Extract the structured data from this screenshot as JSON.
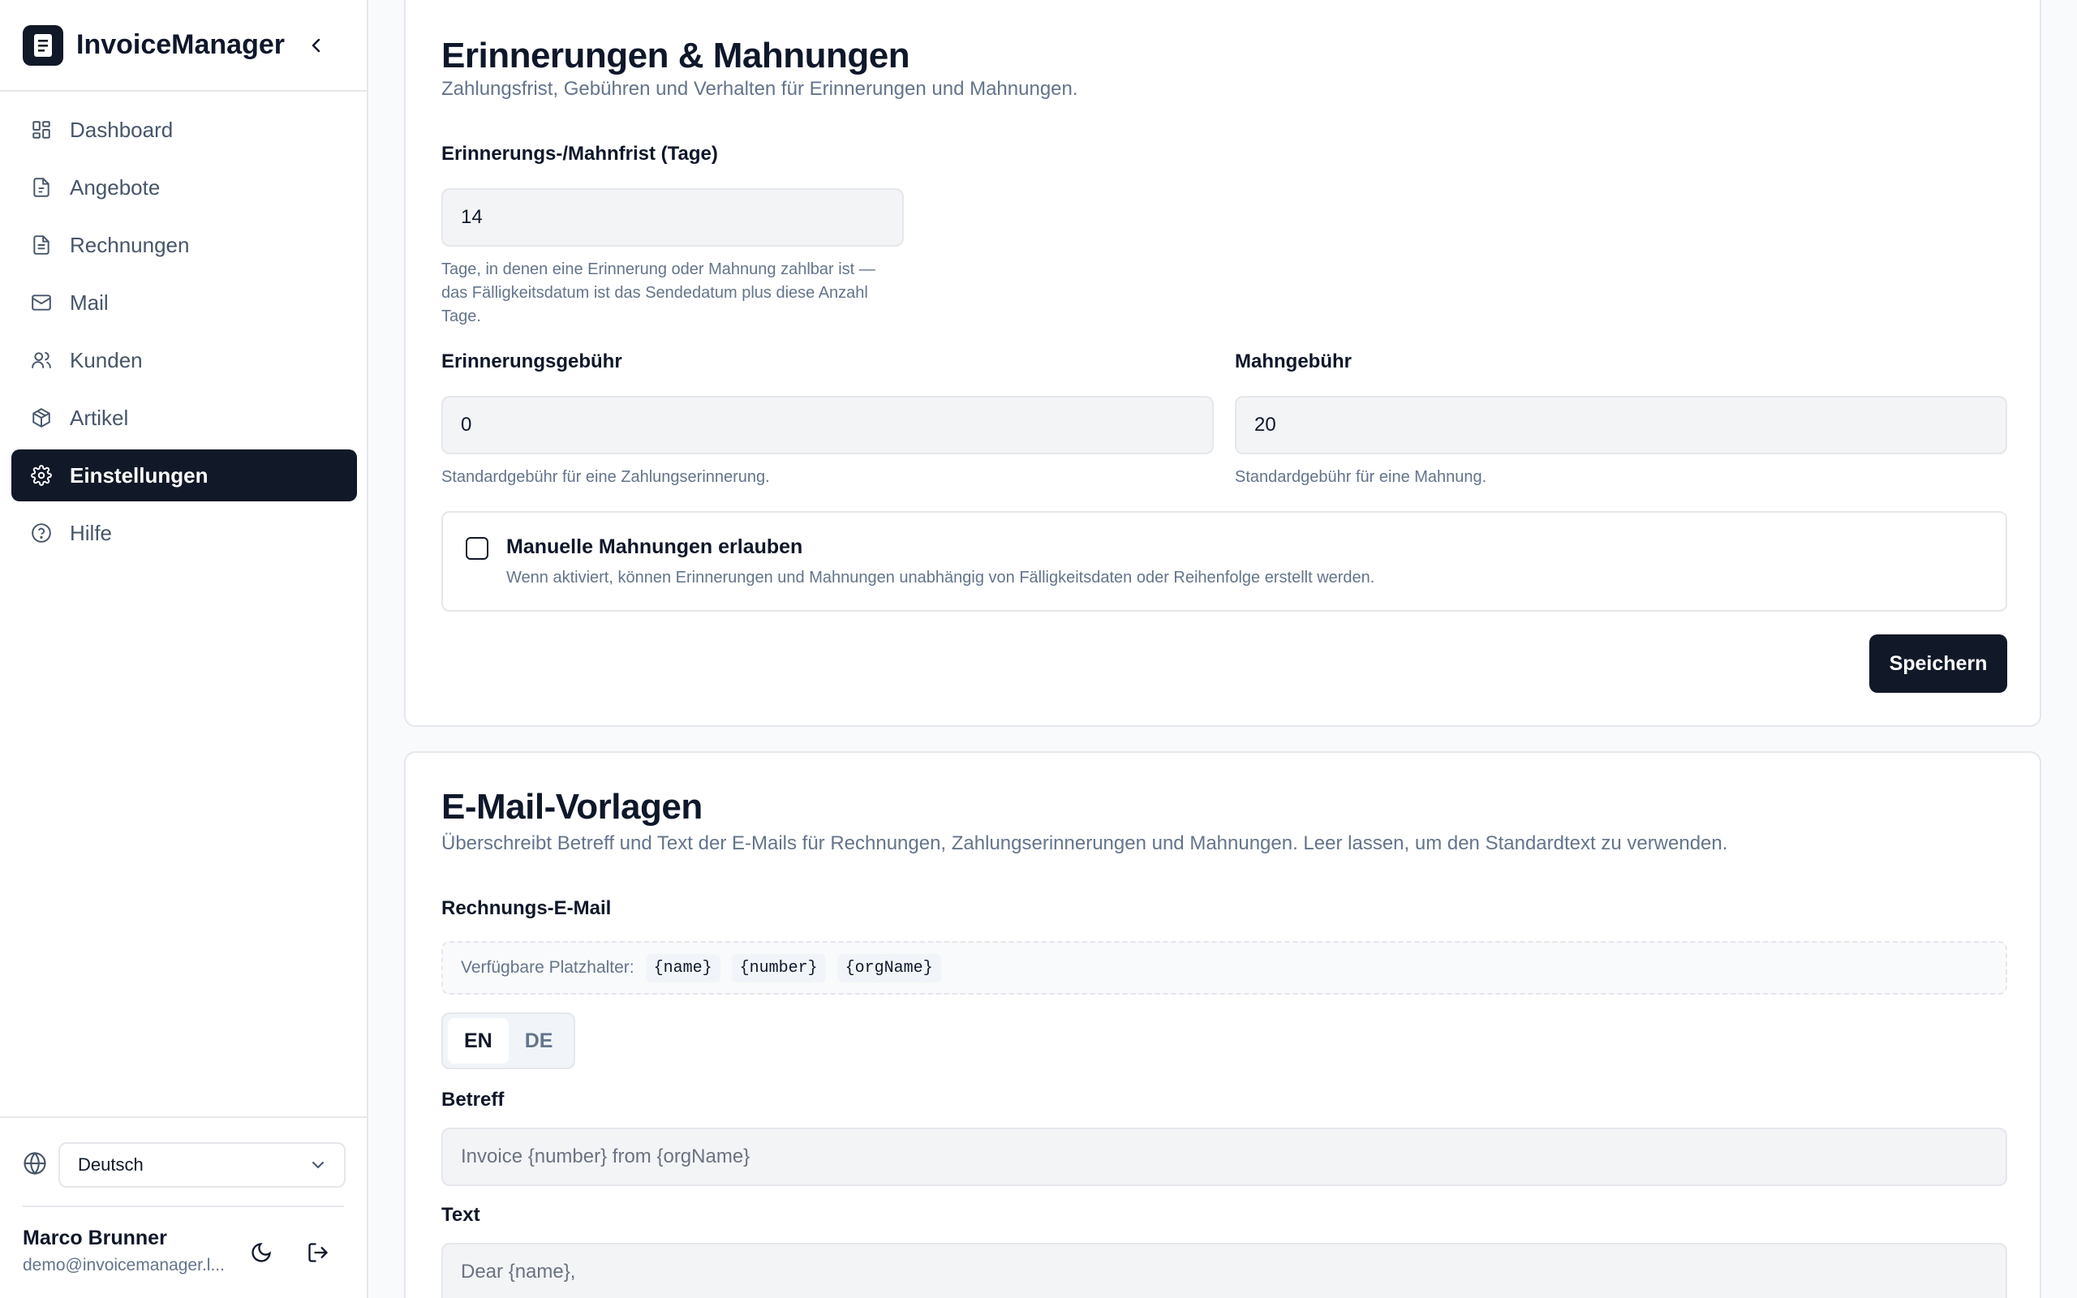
{
  "app": {
    "name": "InvoiceManager"
  },
  "sidebar": {
    "items": [
      {
        "label": "Dashboard",
        "icon": "dashboard-icon"
      },
      {
        "label": "Angebote",
        "icon": "file-icon"
      },
      {
        "label": "Rechnungen",
        "icon": "invoice-icon"
      },
      {
        "label": "Mail",
        "icon": "mail-icon"
      },
      {
        "label": "Kunden",
        "icon": "users-icon"
      },
      {
        "label": "Artikel",
        "icon": "package-icon"
      },
      {
        "label": "Einstellungen",
        "icon": "gear-icon",
        "active": true
      },
      {
        "label": "Hilfe",
        "icon": "help-icon"
      }
    ],
    "language": {
      "selected": "Deutsch"
    },
    "user": {
      "name": "Marco Brunner",
      "email": "demo@invoicemanager.l..."
    }
  },
  "reminders": {
    "title": "Erinnerungen & Mahnungen",
    "subtitle": "Zahlungsfrist, Gebühren und Verhalten für Erinnerungen und Mahnungen.",
    "period": {
      "label": "Erinnerungs-/Mahnfrist (Tage)",
      "value": "14",
      "help_lines": [
        "Tage, in denen eine Erinnerung oder Mahnung zahlbar ist —",
        "das Fälligkeitsdatum ist das Sendedatum plus diese Anzahl",
        "Tage."
      ]
    },
    "reminder_fee": {
      "label": "Erinnerungsgebühr",
      "value": "0",
      "help": "Standardgebühr für eine Zahlungserinnerung."
    },
    "dunning_fee": {
      "label": "Mahngebühr",
      "value": "20",
      "help": "Standardgebühr für eine Mahnung."
    },
    "manual": {
      "label": "Manuelle Mahnungen erlauben",
      "description": "Wenn aktiviert, können Erinnerungen und Mahnungen unabhängig von Fälligkeitsdaten oder Reihenfolge erstellt werden.",
      "checked": false
    },
    "save_label": "Speichern"
  },
  "templates": {
    "title": "E-Mail-Vorlagen",
    "subtitle": "Überschreibt Betreff und Text der E-Mails für Rechnungen, Zahlungserinnerungen und Mahnungen. Leer lassen, um den Standardtext zu verwenden.",
    "invoice_email": {
      "label": "Rechnungs-E-Mail",
      "placeholders_label": "Verfügbare Platzhalter:",
      "placeholders": [
        "{name}",
        "{number}",
        "{orgName}"
      ],
      "languages": [
        "EN",
        "DE"
      ],
      "active_language": "EN",
      "subject_label": "Betreff",
      "subject_placeholder": "Invoice {number} from {orgName}",
      "text_label": "Text",
      "text_placeholder": "Dear {name},"
    }
  },
  "colors": {
    "primary": "#111827",
    "muted": "#64748b",
    "border": "#e5e7eb",
    "input_bg": "#f3f4f6"
  }
}
